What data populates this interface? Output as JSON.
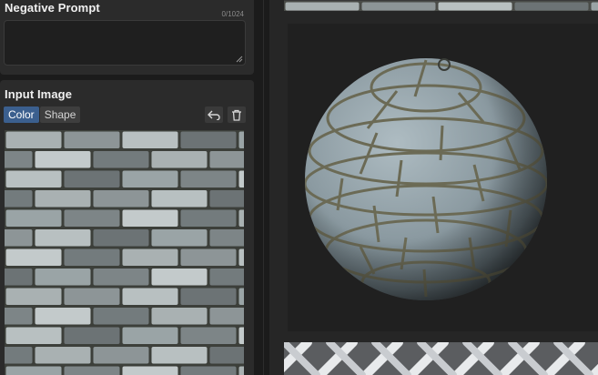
{
  "negative_prompt": {
    "title": "Negative Prompt",
    "counter": "0/1024",
    "value": ""
  },
  "input_image": {
    "title": "Input Image",
    "modes": [
      "Color",
      "Shape"
    ],
    "active_mode": "Color",
    "icons": [
      "undo-icon",
      "trash-icon"
    ]
  },
  "colors": {
    "panel": "#2b2b2b",
    "background": "#1b1b1b",
    "accent": "#3b5f8e",
    "preview_bg": "#202020"
  }
}
